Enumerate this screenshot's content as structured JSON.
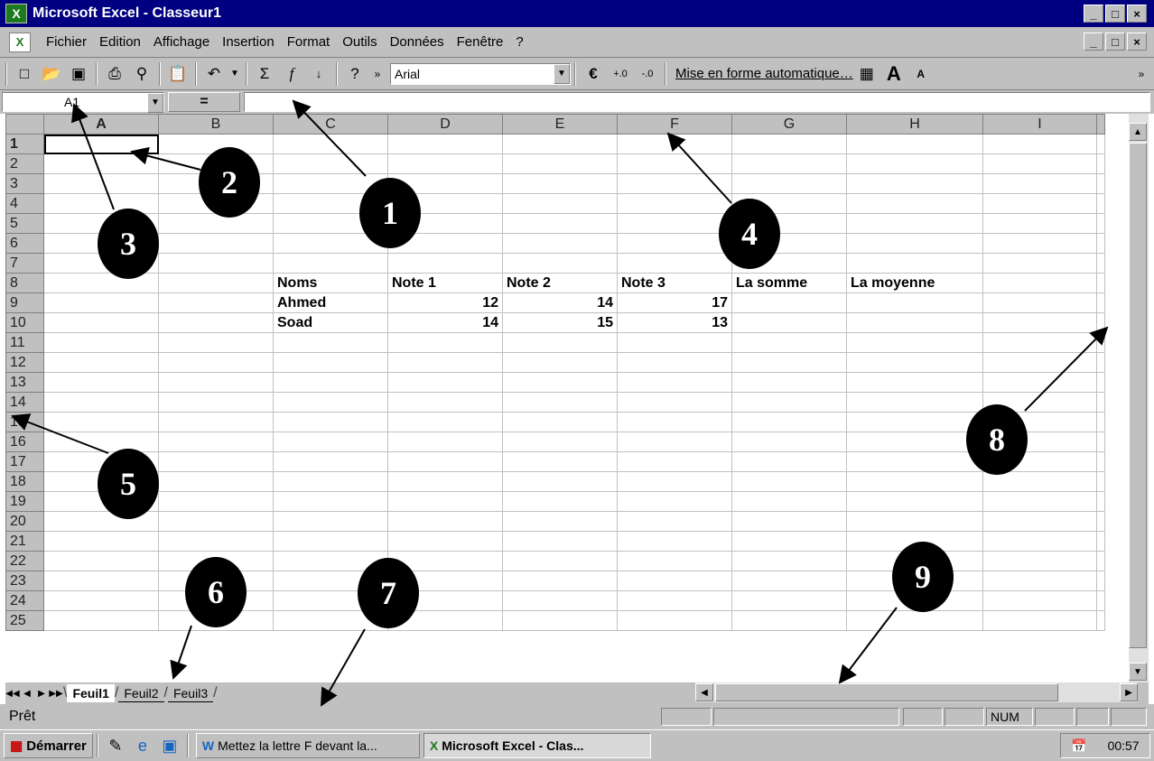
{
  "window": {
    "title": "Microsoft Excel - Classeur1",
    "minimize": "_",
    "maximize": "□",
    "close": "×"
  },
  "menu": {
    "items": [
      "Fichier",
      "Edition",
      "Affichage",
      "Insertion",
      "Format",
      "Outils",
      "Données",
      "Fenêtre",
      "?"
    ]
  },
  "toolbar": {
    "icons": [
      "new-icon",
      "open-icon",
      "save-icon",
      "print-icon",
      "print-preview-icon",
      "paste-icon",
      "undo-icon",
      "autosum-icon",
      "function-icon",
      "sort-icon",
      "help-icon"
    ],
    "font": "Arial",
    "euro": "€",
    "autoformat_label": "Mise en forme automatique…"
  },
  "formula_bar": {
    "name_box": "A1",
    "equals": "=",
    "formula": ""
  },
  "grid": {
    "columns": [
      "A",
      "B",
      "C",
      "D",
      "E",
      "F",
      "G",
      "H",
      "I"
    ],
    "rows": [
      {
        "n": "1",
        "cells": [
          "",
          "",
          "",
          "",
          "",
          "",
          "",
          "",
          ""
        ]
      },
      {
        "n": "2",
        "cells": [
          "",
          "",
          "",
          "",
          "",
          "",
          "",
          "",
          ""
        ]
      },
      {
        "n": "3",
        "cells": [
          "",
          "",
          "",
          "",
          "",
          "",
          "",
          "",
          ""
        ]
      },
      {
        "n": "4",
        "cells": [
          "",
          "",
          "",
          "",
          "",
          "",
          "",
          "",
          ""
        ]
      },
      {
        "n": "5",
        "cells": [
          "",
          "",
          "",
          "",
          "",
          "",
          "",
          "",
          ""
        ]
      },
      {
        "n": "6",
        "cells": [
          "",
          "",
          "",
          "",
          "",
          "",
          "",
          "",
          ""
        ]
      },
      {
        "n": "7",
        "cells": [
          "",
          "",
          "",
          "",
          "",
          "",
          "",
          "",
          ""
        ]
      },
      {
        "n": "8",
        "cells": [
          "",
          "",
          "Noms",
          "Note 1",
          "Note 2",
          "Note 3",
          "La somme",
          "La moyenne",
          ""
        ]
      },
      {
        "n": "9",
        "cells": [
          "",
          "",
          "Ahmed",
          "12",
          "14",
          "17",
          "",
          "",
          ""
        ]
      },
      {
        "n": "10",
        "cells": [
          "",
          "",
          "Soad",
          "14",
          "15",
          "13",
          "",
          "",
          ""
        ]
      },
      {
        "n": "11",
        "cells": [
          "",
          "",
          "",
          "",
          "",
          "",
          "",
          "",
          ""
        ]
      },
      {
        "n": "12",
        "cells": [
          "",
          "",
          "",
          "",
          "",
          "",
          "",
          "",
          ""
        ]
      },
      {
        "n": "13",
        "cells": [
          "",
          "",
          "",
          "",
          "",
          "",
          "",
          "",
          ""
        ]
      },
      {
        "n": "14",
        "cells": [
          "",
          "",
          "",
          "",
          "",
          "",
          "",
          "",
          ""
        ]
      },
      {
        "n": "15",
        "cells": [
          "",
          "",
          "",
          "",
          "",
          "",
          "",
          "",
          ""
        ]
      },
      {
        "n": "16",
        "cells": [
          "",
          "",
          "",
          "",
          "",
          "",
          "",
          "",
          ""
        ]
      },
      {
        "n": "17",
        "cells": [
          "",
          "",
          "",
          "",
          "",
          "",
          "",
          "",
          ""
        ]
      },
      {
        "n": "18",
        "cells": [
          "",
          "",
          "",
          "",
          "",
          "",
          "",
          "",
          ""
        ]
      },
      {
        "n": "19",
        "cells": [
          "",
          "",
          "",
          "",
          "",
          "",
          "",
          "",
          ""
        ]
      },
      {
        "n": "20",
        "cells": [
          "",
          "",
          "",
          "",
          "",
          "",
          "",
          "",
          ""
        ]
      },
      {
        "n": "21",
        "cells": [
          "",
          "",
          "",
          "",
          "",
          "",
          "",
          "",
          ""
        ]
      },
      {
        "n": "22",
        "cells": [
          "",
          "",
          "",
          "",
          "",
          "",
          "",
          "",
          ""
        ]
      },
      {
        "n": "23",
        "cells": [
          "",
          "",
          "",
          "",
          "",
          "",
          "",
          "",
          ""
        ]
      },
      {
        "n": "24",
        "cells": [
          "",
          "",
          "",
          "",
          "",
          "",
          "",
          "",
          ""
        ]
      },
      {
        "n": "25",
        "cells": [
          "",
          "",
          "",
          "",
          "",
          "",
          "",
          "",
          ""
        ]
      }
    ]
  },
  "sheets": {
    "tabs": [
      "Feuil1",
      "Feuil2",
      "Feuil3"
    ],
    "active": "Feuil1"
  },
  "status": {
    "text": "Prêt",
    "num": "NUM"
  },
  "taskbar": {
    "start": "Démarrer",
    "items": [
      "Mettez la lettre F devant la...",
      "Microsoft Excel - Clas..."
    ],
    "clock": "00:57"
  },
  "callouts": [
    "1",
    "2",
    "3",
    "4",
    "5",
    "6",
    "7",
    "8",
    "9"
  ]
}
